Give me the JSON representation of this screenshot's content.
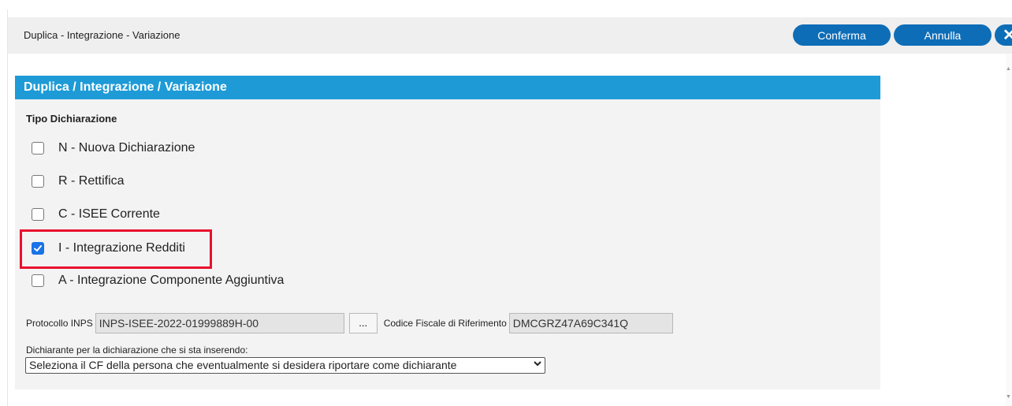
{
  "header": {
    "title": "Duplica - Integrazione - Variazione",
    "confirm_label": "Conferma",
    "cancel_label": "Annulla",
    "close_glyph": "✕"
  },
  "panel": {
    "title": "Duplica / Integrazione / Variazione",
    "section_title": "Tipo Dichiarazione",
    "options": [
      {
        "label": "N - Nuova Dichiarazione",
        "checked": false
      },
      {
        "label": "R - Rettifica",
        "checked": false
      },
      {
        "label": "C - ISEE Corrente",
        "checked": false
      },
      {
        "label": "I - Integrazione Redditi",
        "checked": true
      },
      {
        "label": "A - Integrazione Componente Aggiuntiva",
        "checked": false
      }
    ],
    "protocol_label": "Protocollo INPS",
    "protocol_value": "INPS-ISEE-2022-01999889H-00",
    "browse_label": "...",
    "fiscal_code_label": "Codice Fiscale di Riferimento",
    "fiscal_code_value": "DMCGRZ47A69C341Q",
    "declarant_label": "Dichiarante per la dichiarazione che si sta inserendo:",
    "declarant_select": "Seleziona il CF della persona che eventualmente si desidera riportare come dichiarante"
  },
  "colors": {
    "accent": "#0e6db7",
    "panel_header": "#1e9bd7",
    "highlight": "#e8102d",
    "checkbox_checked": "#1a73e8"
  },
  "icons": [
    "close-icon",
    "check-icon",
    "chevron-down-icon"
  ]
}
